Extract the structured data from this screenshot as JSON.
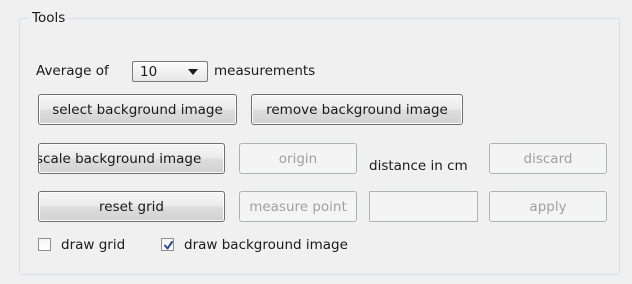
{
  "group": {
    "title": "Tools"
  },
  "average": {
    "prefix": "Average of",
    "value": "10",
    "suffix": "measurements"
  },
  "buttons": {
    "select_bg": "select background image",
    "remove_bg": "remove background image",
    "scale_bg": "scale background image",
    "origin": "origin",
    "discard": "discard",
    "reset_grid": "reset grid",
    "measure_point": "measure point",
    "apply": "apply"
  },
  "distance_label": "distance in cm",
  "distance_value": "",
  "checkboxes": {
    "draw_grid": {
      "label": "draw grid",
      "checked": false
    },
    "draw_bg": {
      "label": "draw background image",
      "checked": true
    }
  },
  "icons": {
    "checkmark": "checkmark-icon",
    "dropdown": "chevron-down-icon"
  },
  "colors": {
    "checkmark": "#2a4f8e",
    "disabled_text": "#a0a0a0"
  }
}
